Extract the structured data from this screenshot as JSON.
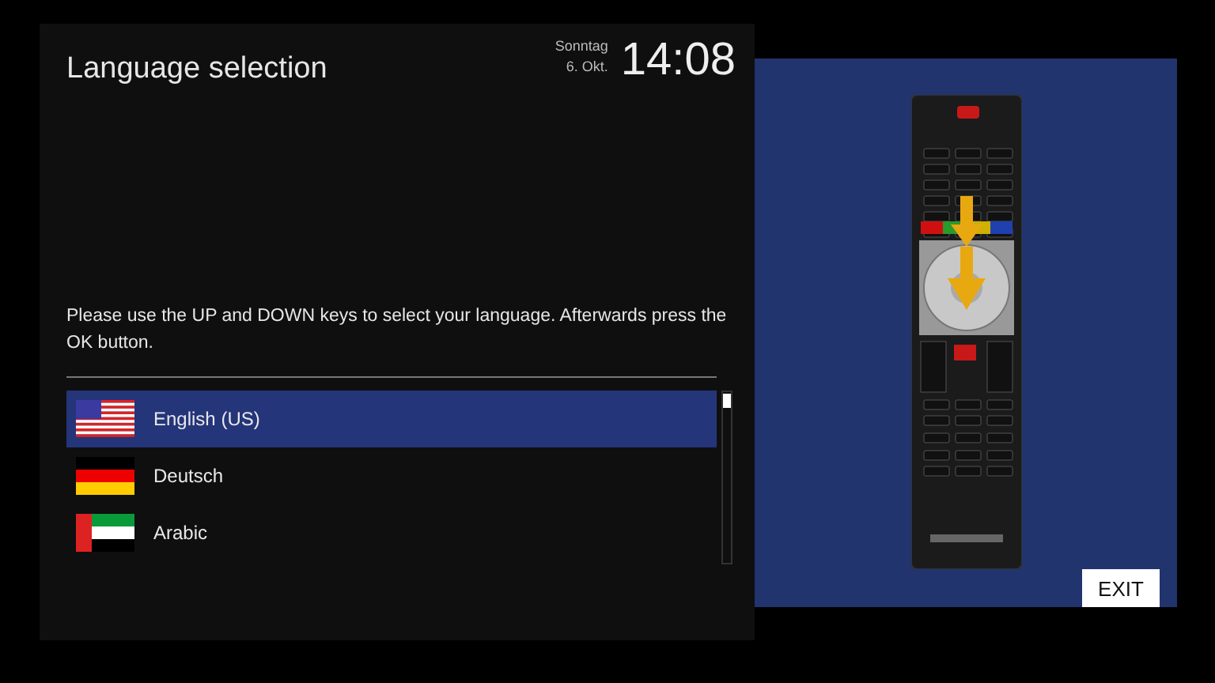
{
  "header": {
    "title": "Language selection",
    "day": "Sonntag",
    "date": "6. Okt.",
    "time": "14:08"
  },
  "instructions": "Please use the UP and DOWN keys to select your language. Afterwards press the OK button.",
  "languages": [
    {
      "label": "English (US)",
      "kind": "us",
      "selected": true
    },
    {
      "label": "Deutsch",
      "kind": "de",
      "selected": false
    },
    {
      "label": "Arabic",
      "kind": "ae",
      "selected": false
    }
  ],
  "exit_button": "EXIT"
}
